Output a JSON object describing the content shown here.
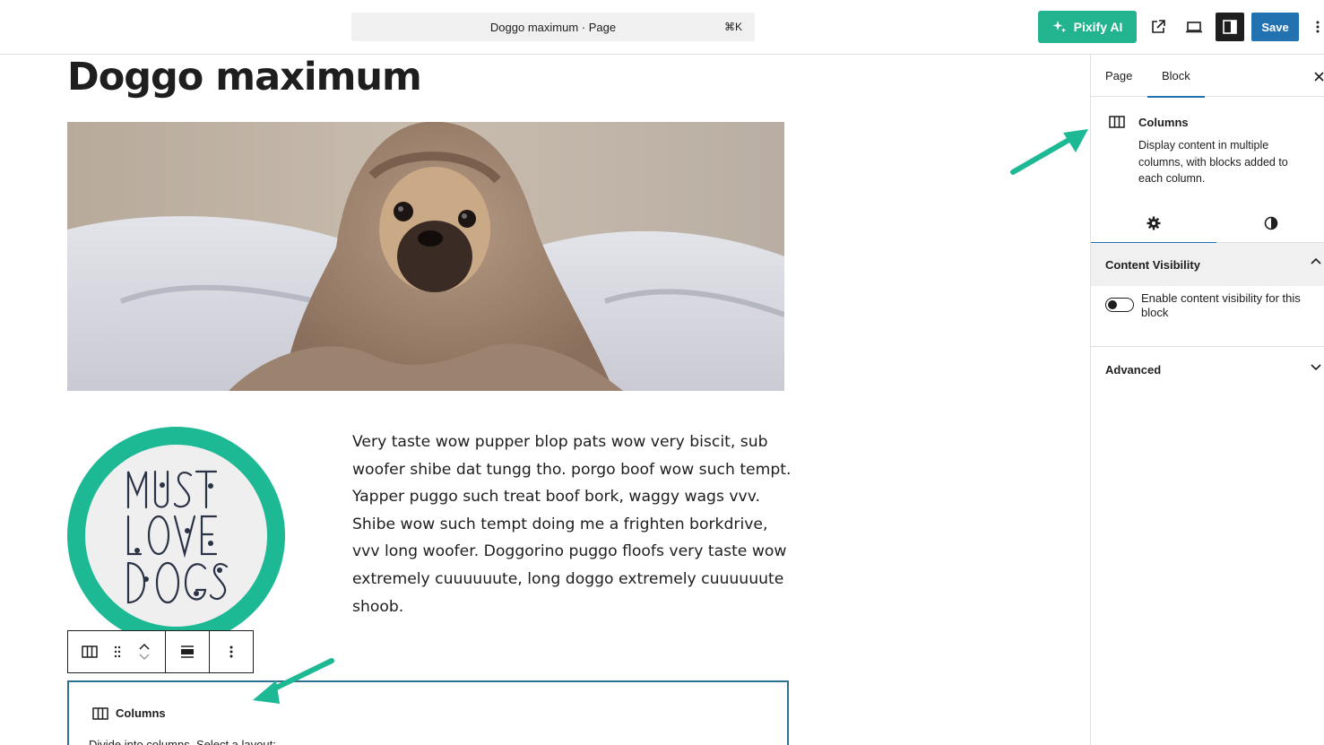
{
  "header": {
    "command_title": "Doggo maximum · Page",
    "shortcut": "⌘K",
    "pixify_label": "Pixify AI",
    "save_label": "Save"
  },
  "colors": {
    "accent_green": "#22b38f",
    "save_blue": "#2271b1",
    "badge_teal": "#1db995"
  },
  "content": {
    "page_title": "Doggo maximum",
    "image_subject": "pug wrapped in a blanket on a bed",
    "badge_text": "MUST LOVE DOGS",
    "body_text": "Very taste wow pupper blop pats wow very biscit, sub woofer shibe dat tungg tho. porgo boof wow such tempt. Yapper puggo such treat boof bork, waggy wags vvv. Shibe wow such tempt doing me a frighten borkdrive, vvv long woofer. Doggorino puggo floofs very taste wow extremely cuuuuuute, long doggo extremely cuuuuuute shoob."
  },
  "placeholder": {
    "title": "Columns",
    "subtitle": "Divide into columns. Select a layout:"
  },
  "sidebar": {
    "tabs": [
      {
        "label": "Page",
        "active": false
      },
      {
        "label": "Block",
        "active": true
      }
    ],
    "block": {
      "title": "Columns",
      "description": "Display content in multiple columns, with blocks added to each column."
    },
    "subtabs": [
      {
        "icon": "gear-icon",
        "active": true
      },
      {
        "icon": "contrast-icon",
        "active": false
      }
    ],
    "content_visibility": {
      "title": "Content Visibility",
      "toggle_label": "Enable content visibility for this block",
      "enabled": false
    },
    "advanced": {
      "title": "Advanced"
    }
  }
}
